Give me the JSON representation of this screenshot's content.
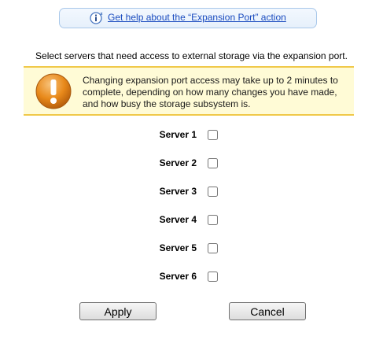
{
  "help": {
    "icon": "info-icon",
    "link_text": "Get help about the “Expansion Port” action"
  },
  "intro_text": "Select servers that need access to external storage via the expansion port.",
  "warning": {
    "icon": "warning-exclamation-icon",
    "text": "Changing expansion port access may take up to 2 minutes to complete, depending on how many changes you have made, and how busy the storage subsystem is."
  },
  "servers": [
    {
      "label": "Server 1",
      "checked": false
    },
    {
      "label": "Server 2",
      "checked": false
    },
    {
      "label": "Server 3",
      "checked": false
    },
    {
      "label": "Server 4",
      "checked": false
    },
    {
      "label": "Server 5",
      "checked": false
    },
    {
      "label": "Server 6",
      "checked": false
    }
  ],
  "buttons": {
    "apply_label": "Apply",
    "cancel_label": "Cancel"
  },
  "colors": {
    "link": "#1a4bbf",
    "warning_bg": "#fffbd6",
    "warning_border": "#f0c94a",
    "warning_icon": "#e8891a"
  }
}
